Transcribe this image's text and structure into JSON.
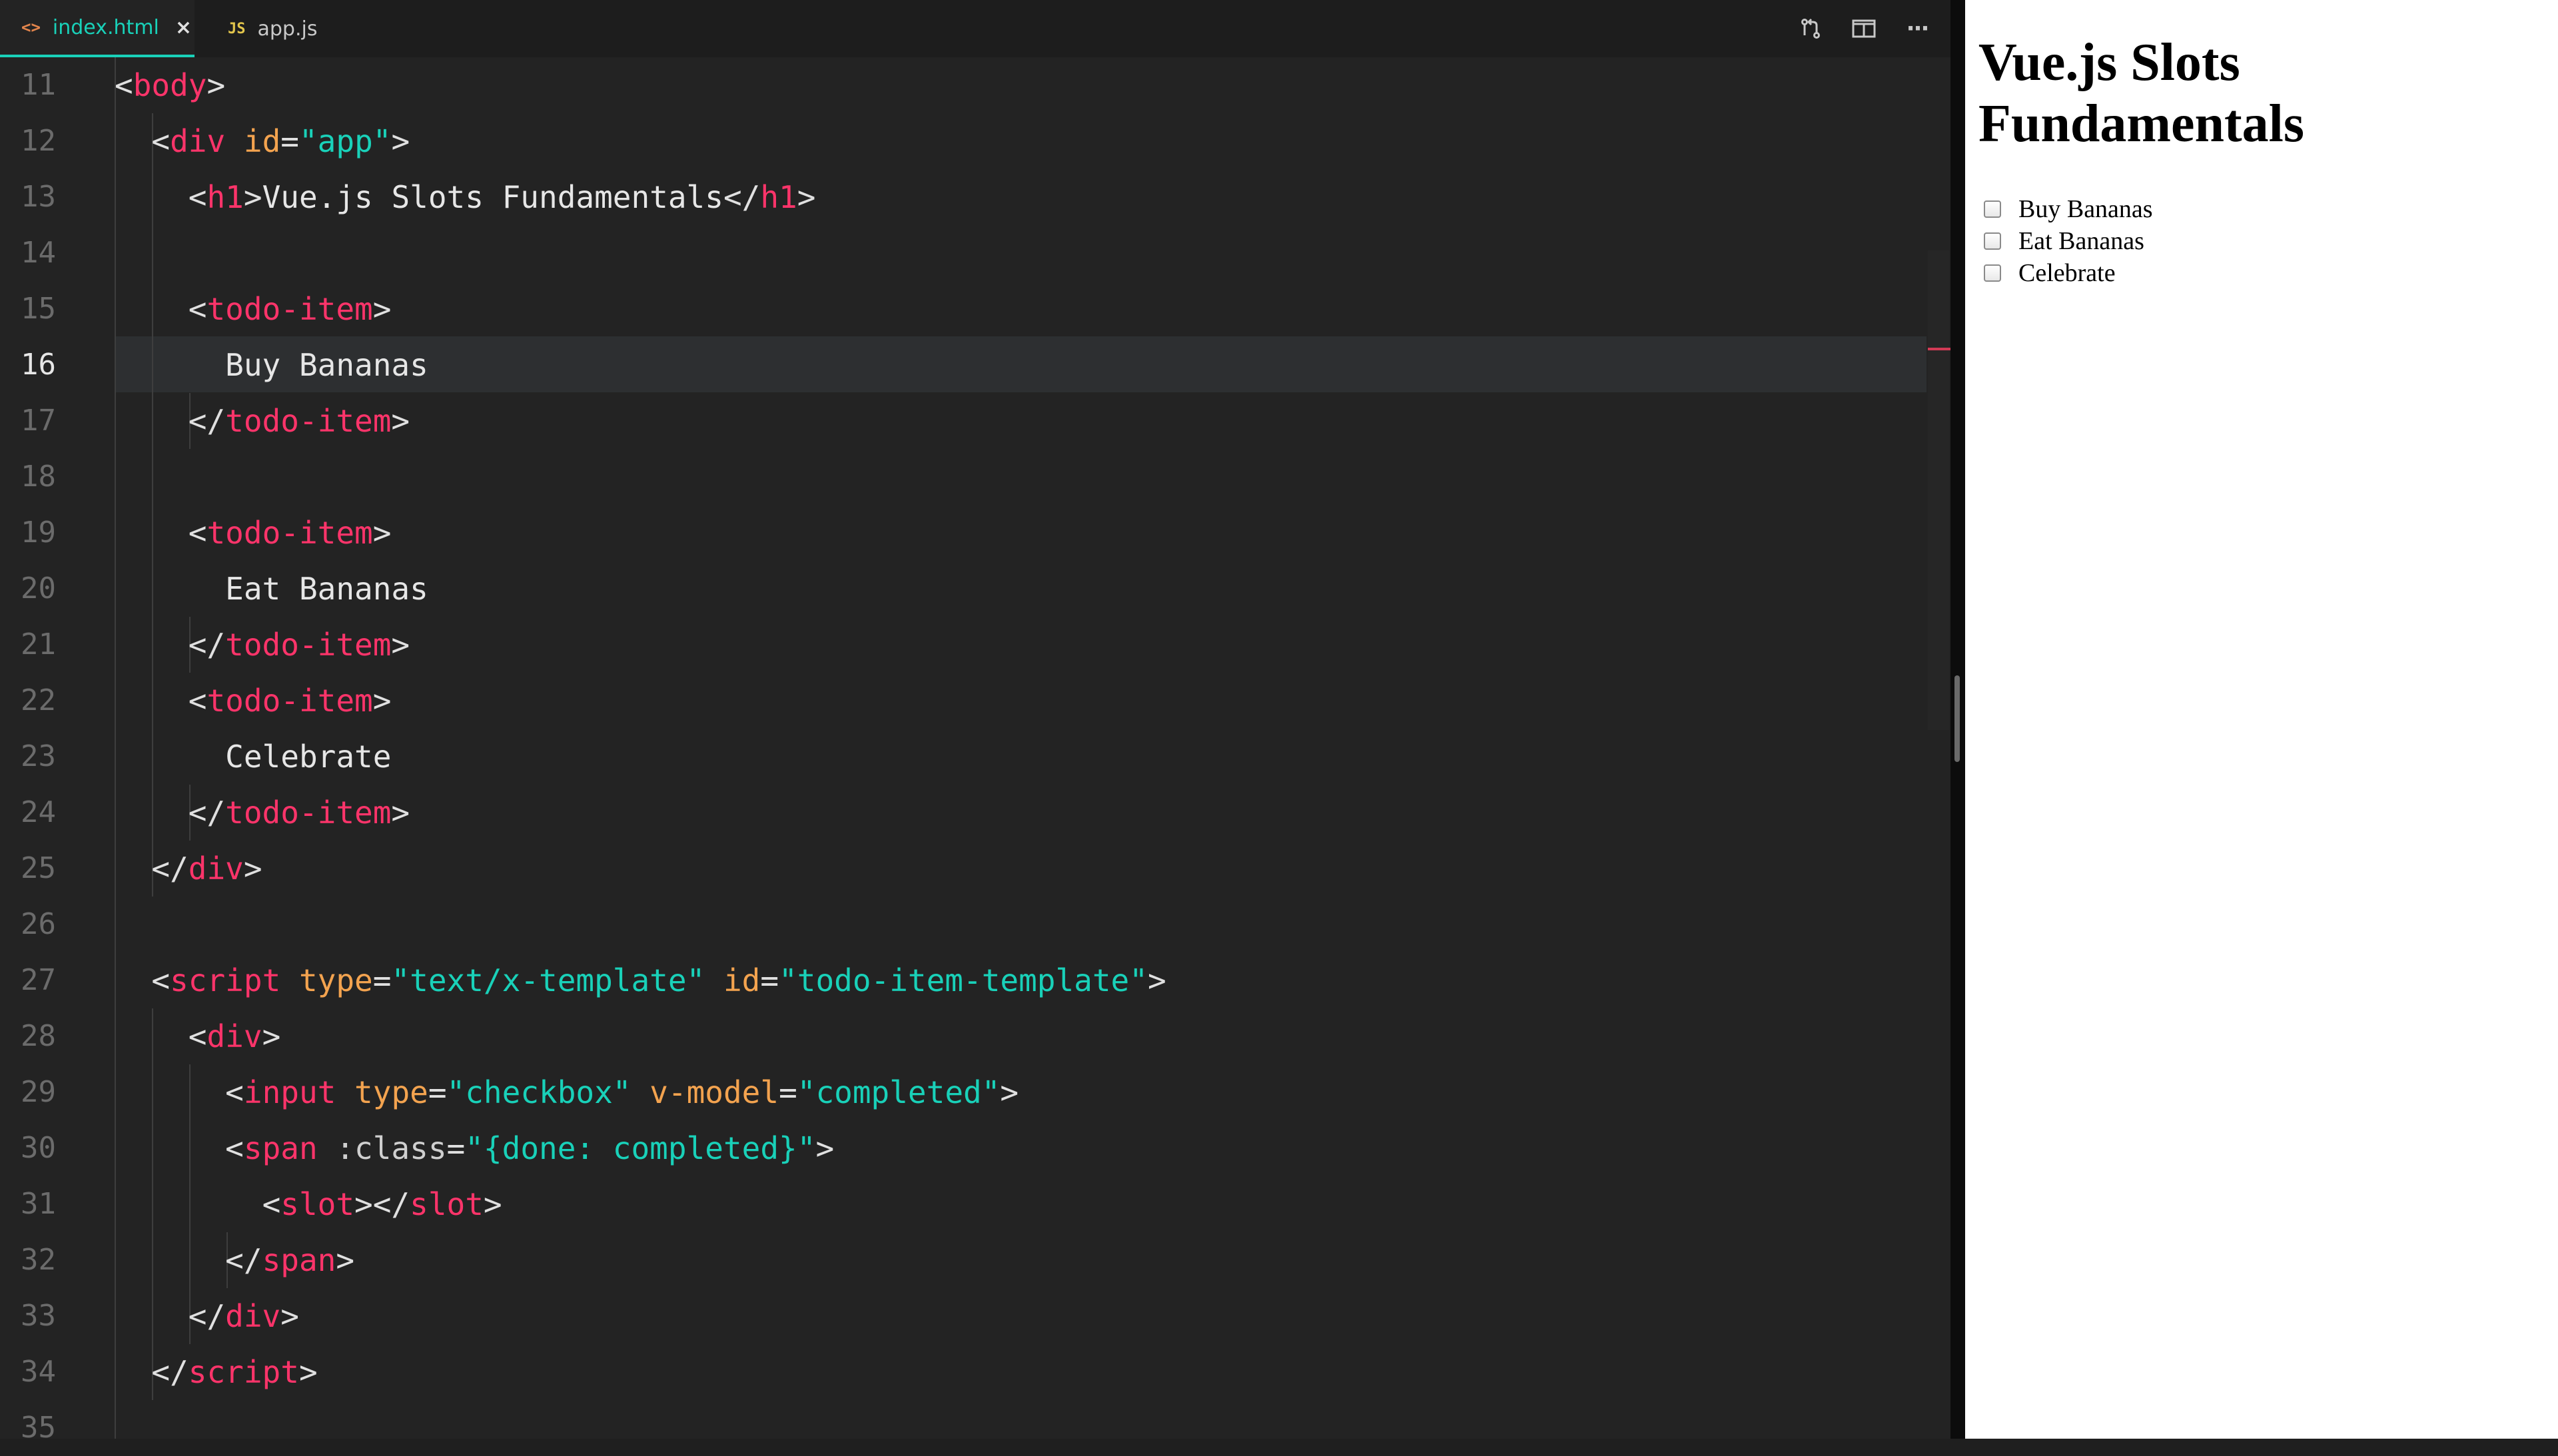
{
  "tabs": [
    {
      "icon": "<>",
      "label": "index.html",
      "active": true,
      "close": "×"
    },
    {
      "icon": "JS",
      "label": "app.js",
      "active": false
    }
  ],
  "toolbar": {
    "icons": [
      "source-control-icon",
      "split-editor-icon",
      "more-actions-icon"
    ],
    "more_label": "···"
  },
  "editor": {
    "active_line": "16",
    "line_numbers": [
      "11",
      "12",
      "13",
      "14",
      "15",
      "16",
      "17",
      "18",
      "19",
      "20",
      "21",
      "22",
      "23",
      "24",
      "25",
      "26",
      "27",
      "28",
      "29",
      "30",
      "31",
      "32",
      "33",
      "34",
      "35"
    ],
    "lines": [
      {
        "indent": "",
        "tokens": [
          [
            "pn",
            "<"
          ],
          [
            "tag",
            "body"
          ],
          [
            "pn",
            ">"
          ]
        ]
      },
      {
        "indent": "  ",
        "tokens": [
          [
            "pn",
            "<"
          ],
          [
            "tag",
            "div"
          ],
          [
            "attr",
            " id"
          ],
          [
            "pn",
            "="
          ],
          [
            "str",
            "\"app\""
          ],
          [
            "pn",
            ">"
          ]
        ]
      },
      {
        "indent": "    ",
        "tokens": [
          [
            "pn",
            "<"
          ],
          [
            "tag",
            "h1"
          ],
          [
            "pn",
            ">"
          ],
          [
            "txt",
            "Vue.js Slots Fundamentals"
          ],
          [
            "pn",
            "</"
          ],
          [
            "tag",
            "h1"
          ],
          [
            "pn",
            ">"
          ]
        ]
      },
      {
        "indent": "",
        "tokens": []
      },
      {
        "indent": "    ",
        "tokens": [
          [
            "pn",
            "<"
          ],
          [
            "tag",
            "todo-item"
          ],
          [
            "pn",
            ">"
          ]
        ]
      },
      {
        "indent": "      ",
        "tokens": [
          [
            "txt",
            "Buy Bananas"
          ]
        ]
      },
      {
        "indent": "    ",
        "tokens": [
          [
            "pn",
            "</"
          ],
          [
            "tag",
            "todo-item"
          ],
          [
            "pn",
            ">"
          ]
        ]
      },
      {
        "indent": "",
        "tokens": []
      },
      {
        "indent": "    ",
        "tokens": [
          [
            "pn",
            "<"
          ],
          [
            "tag",
            "todo-item"
          ],
          [
            "pn",
            ">"
          ]
        ]
      },
      {
        "indent": "      ",
        "tokens": [
          [
            "txt",
            "Eat Bananas"
          ]
        ]
      },
      {
        "indent": "    ",
        "tokens": [
          [
            "pn",
            "</"
          ],
          [
            "tag",
            "todo-item"
          ],
          [
            "pn",
            ">"
          ]
        ]
      },
      {
        "indent": "    ",
        "tokens": [
          [
            "pn",
            "<"
          ],
          [
            "tag",
            "todo-item"
          ],
          [
            "pn",
            ">"
          ]
        ]
      },
      {
        "indent": "      ",
        "tokens": [
          [
            "txt",
            "Celebrate"
          ]
        ]
      },
      {
        "indent": "    ",
        "tokens": [
          [
            "pn",
            "</"
          ],
          [
            "tag",
            "todo-item"
          ],
          [
            "pn",
            ">"
          ]
        ]
      },
      {
        "indent": "  ",
        "tokens": [
          [
            "pn",
            "</"
          ],
          [
            "tag",
            "div"
          ],
          [
            "pn",
            ">"
          ]
        ]
      },
      {
        "indent": "",
        "tokens": []
      },
      {
        "indent": "  ",
        "tokens": [
          [
            "pn",
            "<"
          ],
          [
            "tag",
            "script"
          ],
          [
            "attr",
            " type"
          ],
          [
            "pn",
            "="
          ],
          [
            "str",
            "\"text/x-template\""
          ],
          [
            "attr",
            " id"
          ],
          [
            "pn",
            "="
          ],
          [
            "str",
            "\"todo-item-template\""
          ],
          [
            "pn",
            ">"
          ]
        ]
      },
      {
        "indent": "    ",
        "tokens": [
          [
            "pn",
            "<"
          ],
          [
            "tag",
            "div"
          ],
          [
            "pn",
            ">"
          ]
        ]
      },
      {
        "indent": "      ",
        "tokens": [
          [
            "pn",
            "<"
          ],
          [
            "tag",
            "input"
          ],
          [
            "attr",
            " type"
          ],
          [
            "pn",
            "="
          ],
          [
            "str",
            "\"checkbox\""
          ],
          [
            "attr",
            " v-model"
          ],
          [
            "pn",
            "="
          ],
          [
            "str",
            "\"completed\""
          ],
          [
            "pn",
            ">"
          ]
        ]
      },
      {
        "indent": "      ",
        "tokens": [
          [
            "pn",
            "<"
          ],
          [
            "tag",
            "span"
          ],
          [
            "dir",
            " :class"
          ],
          [
            "pn",
            "="
          ],
          [
            "str",
            "\"{done: completed}\""
          ],
          [
            "pn",
            ">"
          ]
        ]
      },
      {
        "indent": "        ",
        "tokens": [
          [
            "pn",
            "<"
          ],
          [
            "tag",
            "slot"
          ],
          [
            "pn",
            "></"
          ],
          [
            "tag",
            "slot"
          ],
          [
            "pn",
            ">"
          ]
        ]
      },
      {
        "indent": "      ",
        "tokens": [
          [
            "pn",
            "</"
          ],
          [
            "tag",
            "span"
          ],
          [
            "pn",
            ">"
          ]
        ]
      },
      {
        "indent": "    ",
        "tokens": [
          [
            "pn",
            "</"
          ],
          [
            "tag",
            "div"
          ],
          [
            "pn",
            ">"
          ]
        ]
      },
      {
        "indent": "  ",
        "tokens": [
          [
            "pn",
            "</"
          ],
          [
            "tag",
            "script"
          ],
          [
            "pn",
            ">"
          ]
        ]
      },
      {
        "indent": "",
        "tokens": []
      }
    ]
  },
  "preview": {
    "title": "Vue.js Slots Fundamentals",
    "items": [
      "Buy Bananas",
      "Eat Bananas",
      "Celebrate"
    ]
  }
}
